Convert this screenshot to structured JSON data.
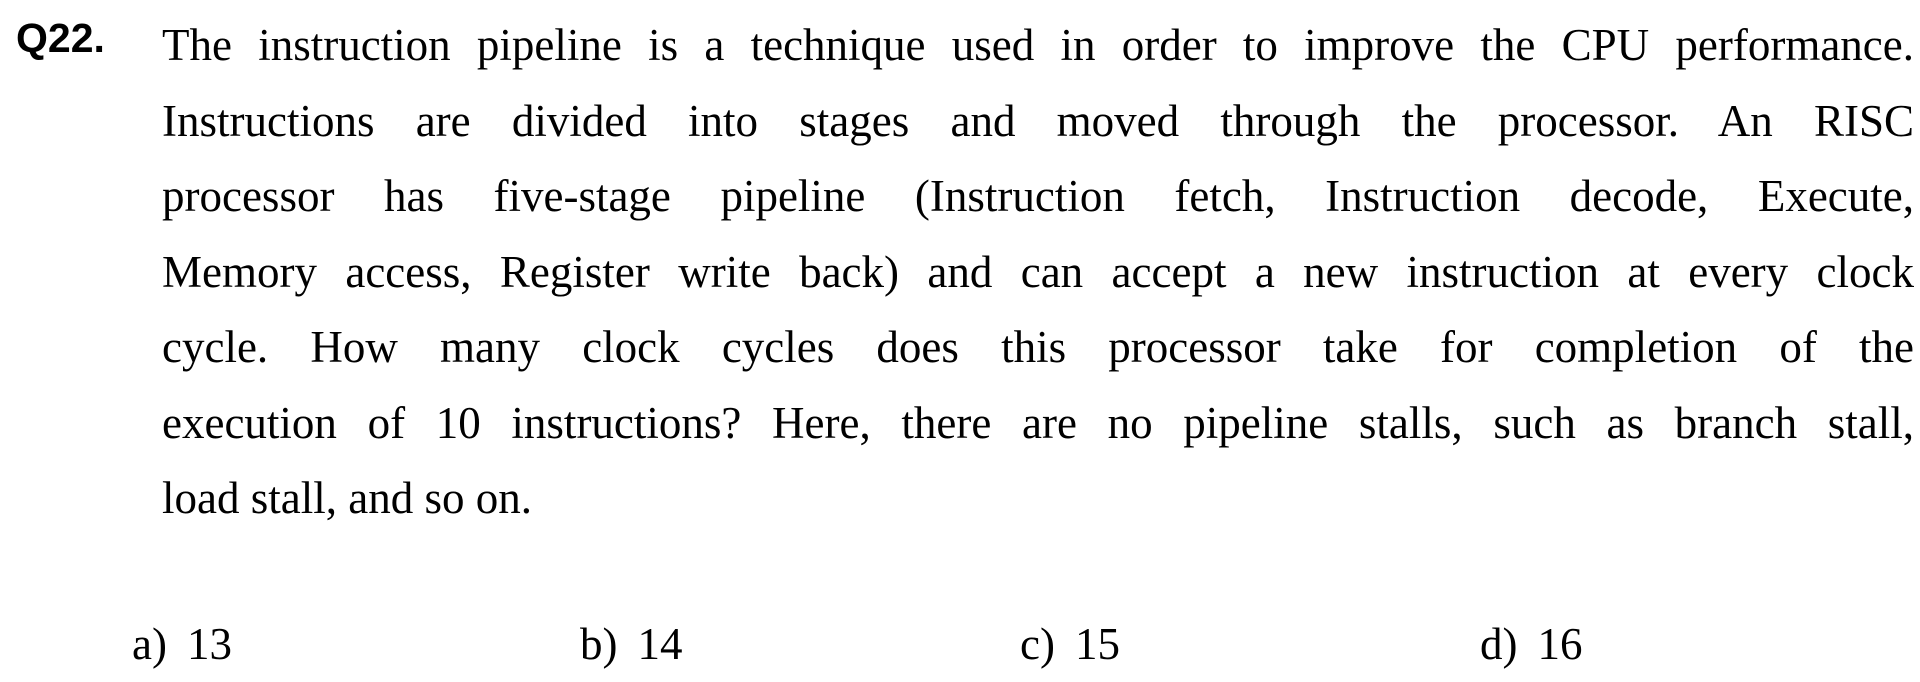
{
  "question": {
    "number": "Q22.",
    "lines": [
      "The instruction pipeline is a technique used in order to improve the CPU performance.",
      "Instructions are divided into stages and moved through the processor.   An RISC",
      "processor has five-stage pipeline (Instruction fetch, Instruction decode, Execute,",
      "Memory access, Register write back) and can accept a new instruction at every clock",
      "cycle.   How many clock cycles does this processor take for completion of the",
      "execution of 10 instructions?   Here, there are no pipeline stalls, such as branch stall,",
      "load stall, and so on."
    ]
  },
  "options": [
    {
      "letter": "a)",
      "value": "13"
    },
    {
      "letter": "b)",
      "value": "14"
    },
    {
      "letter": "c)",
      "value": "15"
    },
    {
      "letter": "d)",
      "value": "16"
    }
  ]
}
